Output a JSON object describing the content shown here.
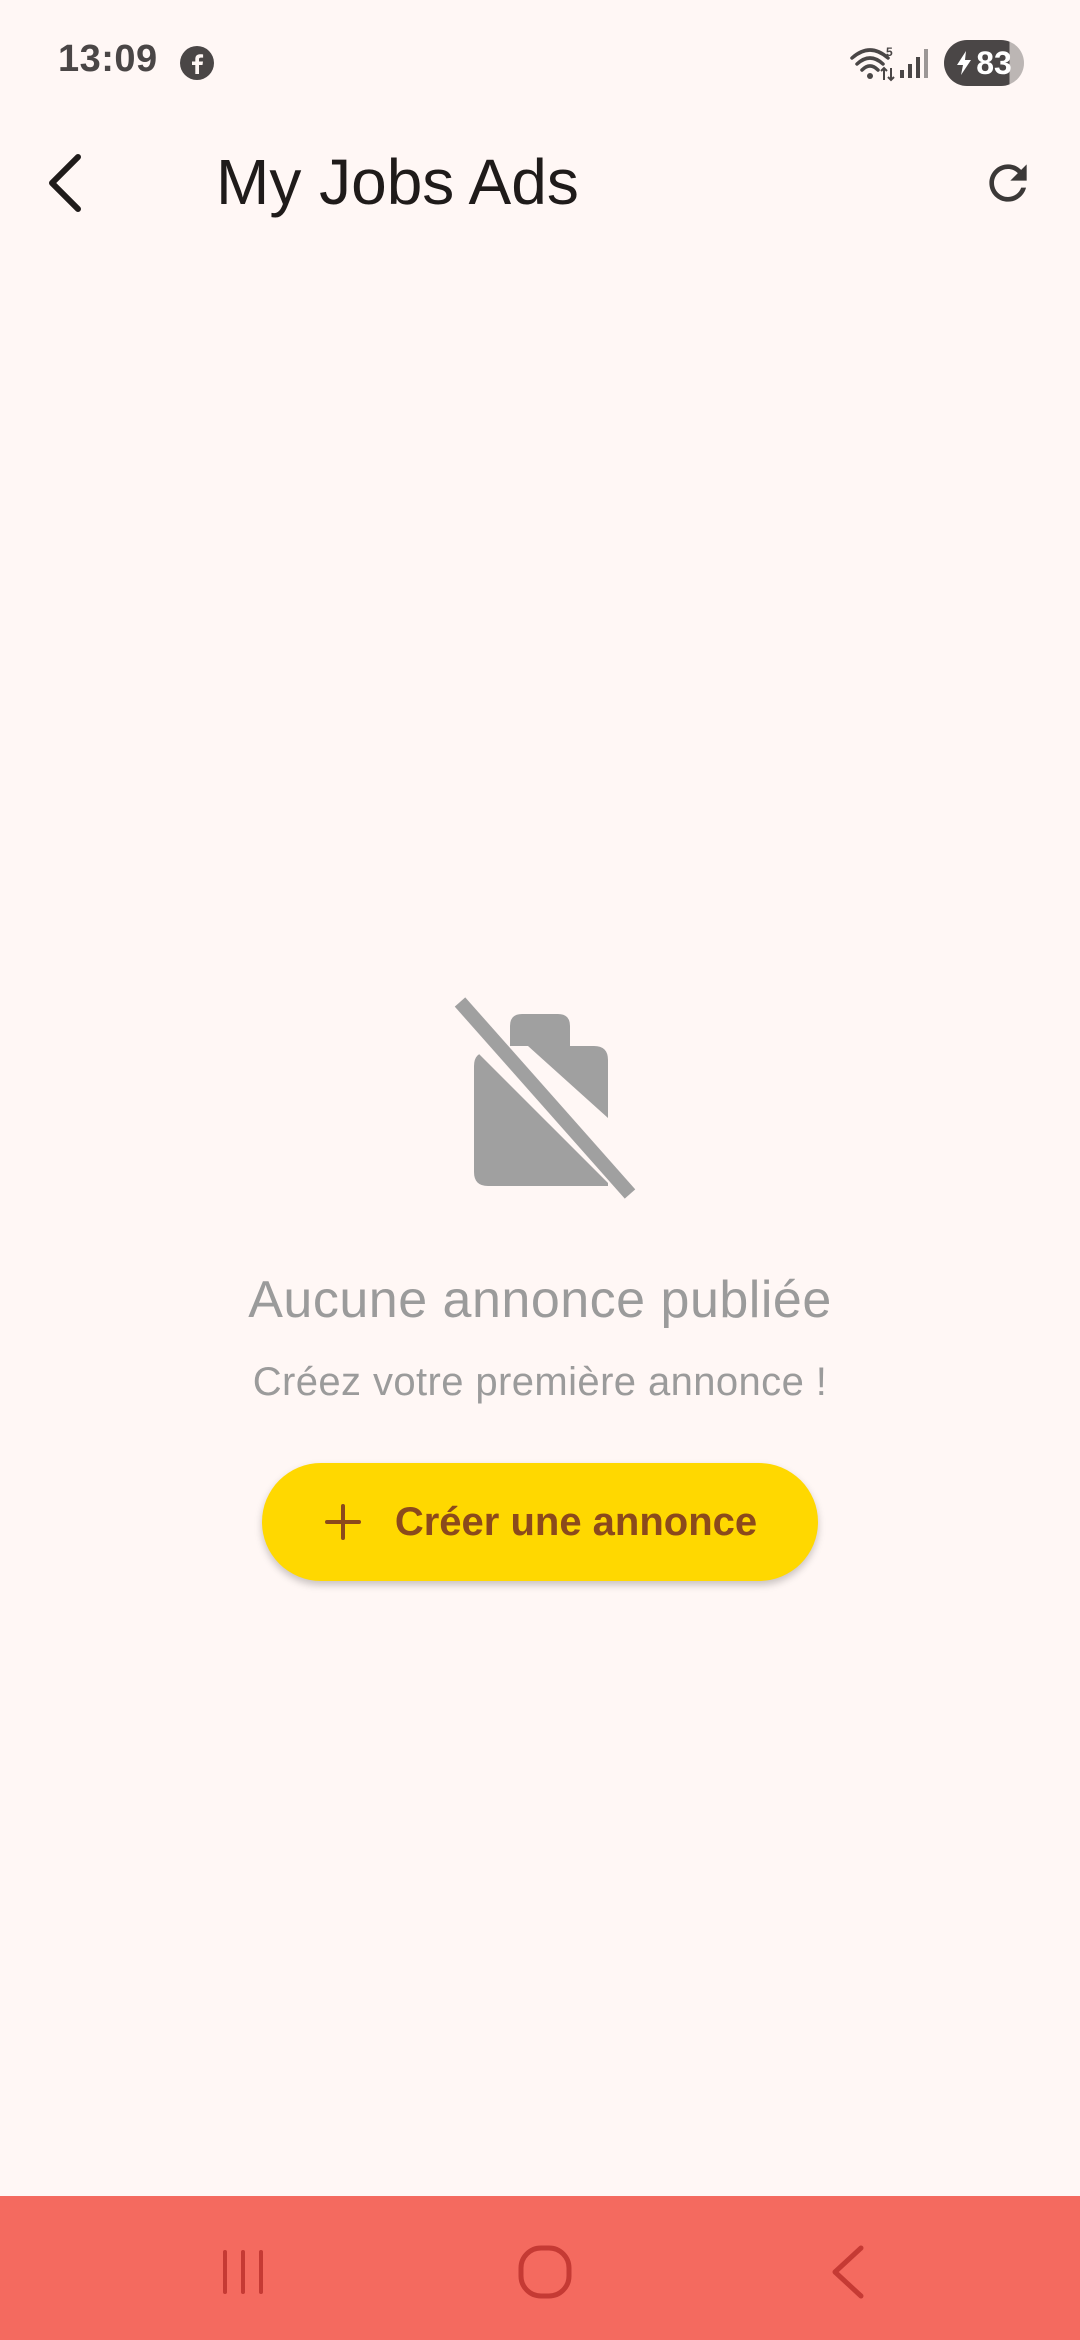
{
  "status_bar": {
    "time": "13:09",
    "battery": "83",
    "notification_icon": "facebook-icon",
    "icons": [
      "wifi-icon",
      "signal-icon",
      "battery-charging-icon"
    ]
  },
  "app_bar": {
    "title": "My Jobs Ads",
    "back_icon": "back-arrow-icon",
    "refresh_icon": "refresh-icon"
  },
  "empty_state": {
    "icon": "work-off-icon",
    "title": "Aucune annonce publiée",
    "subtitle": "Créez votre première annonce !",
    "button_label": "Créer une annonce",
    "button_icon": "plus-icon"
  },
  "nav_bar": {
    "items": [
      "recents-icon",
      "home-icon",
      "back-icon"
    ]
  },
  "colors": {
    "background": "#FFF7F5",
    "accent_button": "#FFD800",
    "button_text": "#8B4A1C",
    "muted_text": "#9B9B9B",
    "nav_bar": "#F46A5F"
  }
}
